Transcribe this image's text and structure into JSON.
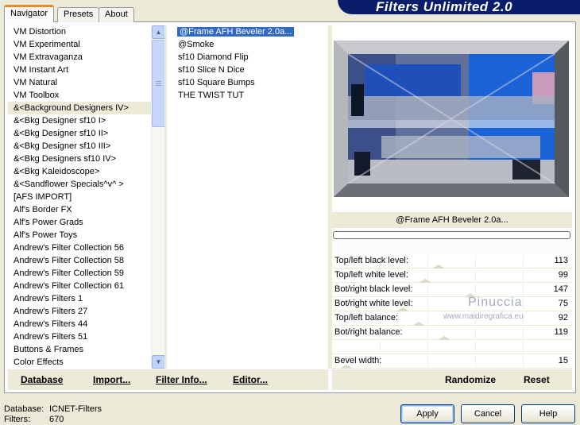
{
  "banner": {
    "title": "Filters Unlimited 2.0"
  },
  "tabs": [
    {
      "label": "Navigator",
      "active": true
    },
    {
      "label": "Presets",
      "active": false
    },
    {
      "label": "About",
      "active": false
    }
  ],
  "categories": [
    "VM Distortion",
    "VM Experimental",
    "VM Extravaganza",
    "VM Instant Art",
    "VM Natural",
    "VM Toolbox",
    "&<Background Designers IV>",
    "&<Bkg Designer sf10 I>",
    "&<Bkg Designer sf10 II>",
    "&<Bkg Designer sf10 III>",
    "&<Bkg Designers sf10 IV>",
    "&<Bkg Kaleidoscope>",
    "&<Sandflower Specials^v^ >",
    "[AFS IMPORT]",
    "Alf's Border FX",
    "Alf's Power Grads",
    "Alf's Power Toys",
    "Andrew's Filter Collection 56",
    "Andrew's Filter Collection 58",
    "Andrew's Filter Collection 59",
    "Andrew's Filter Collection 61",
    "Andrew's Filters 1",
    "Andrew's Filters 27",
    "Andrew's Filters 44",
    "Andrew's Filters 51",
    "Buttons & Frames",
    "Color Effects"
  ],
  "selected_category": 6,
  "filters": [
    "@Frame AFH Beveler 2.0a...",
    "@Smoke",
    "sf10 Diamond Flip",
    "sf10 Slice N Dice",
    "sf10 Square Bumps",
    "THE TWIST TUT"
  ],
  "selected_filter": 0,
  "preview": {
    "filter_name": "@Frame AFH Beveler 2.0a..."
  },
  "params": [
    {
      "label": "Top/left black level:",
      "value": "113",
      "level": 113
    },
    {
      "label": "Top/left white level:",
      "value": "99",
      "level": 99
    },
    {
      "label": "Bot/right black level:",
      "value": "147",
      "level": 147
    },
    {
      "label": "Bot/right white level:",
      "value": "75",
      "level": 75
    },
    {
      "label": "Top/left balance:",
      "value": "92",
      "level": 92
    },
    {
      "label": "Bot/right balance:",
      "value": "119",
      "level": 119
    },
    {
      "label": "",
      "value": "",
      "level": null
    },
    {
      "label": "Bevel width:",
      "value": "15",
      "level": 15
    }
  ],
  "watermark": {
    "line1": "Pinuccia",
    "line2": "www.maidiregrafica.eu"
  },
  "bottom_left": {
    "database": "Database",
    "import": "Import...",
    "filter_info": "Filter Info...",
    "editor": "Editor..."
  },
  "bottom_right": {
    "randomize": "Randomize",
    "reset": "Reset"
  },
  "status": {
    "database_label": "Database:",
    "database_value": "ICNET-Filters",
    "filters_label": "Filters:",
    "filters_value": "670"
  },
  "dialog": {
    "apply": "Apply",
    "cancel": "Cancel",
    "help": "Help"
  },
  "colors": {
    "banner": "#0a1d6b",
    "selection": "#316ac5",
    "tab_accent": "#e68b2c"
  }
}
